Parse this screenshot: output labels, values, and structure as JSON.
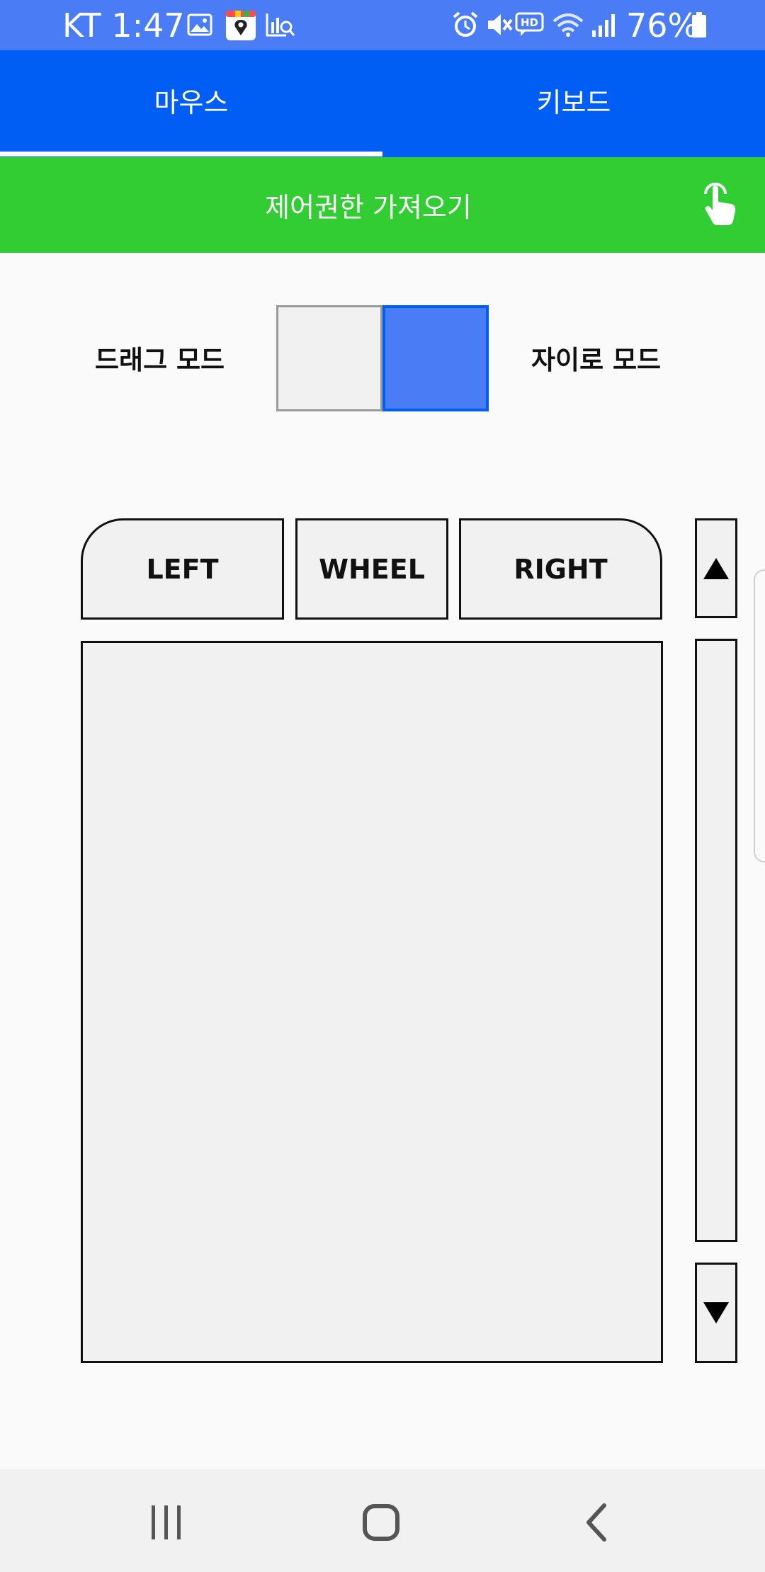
{
  "status_bar": {
    "carrier_time": "KT 1:47",
    "battery": "76%",
    "icons": [
      "gallery-icon",
      "map-pin-app-icon",
      "chart-search-icon",
      "alarm-icon",
      "mute-icon",
      "hd-voice-icon",
      "wifi-icon",
      "signal-icon",
      "battery-icon"
    ]
  },
  "tabs": [
    {
      "label": "마우스",
      "selected": true
    },
    {
      "label": "키보드",
      "selected": false
    }
  ],
  "control_bar": {
    "label": "제어권한 가져오기",
    "icon": "touch-hand-icon"
  },
  "mode_switch": {
    "left_label": "드래그 모드",
    "right_label": "자이로 모드",
    "selected": "right"
  },
  "mouse_buttons": {
    "left": "LEFT",
    "wheel": "WHEEL",
    "right": "RIGHT"
  },
  "scroll": {
    "up_icon": "triangle-up-icon",
    "down_icon": "triangle-down-icon"
  },
  "nav_bar": {
    "icons": [
      "recents-icon",
      "home-icon",
      "back-icon"
    ]
  },
  "colors": {
    "status_bar": "#4a7cf6",
    "tab_bar": "#005ef5",
    "control_bar": "#32cd32",
    "mode_selected": "#4a7cf6"
  }
}
